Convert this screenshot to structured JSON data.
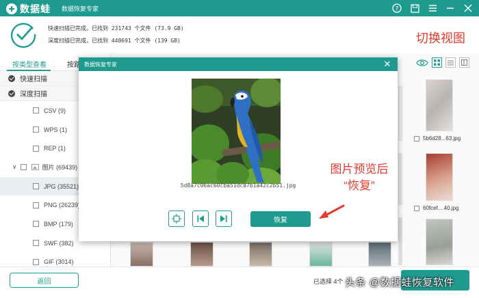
{
  "app": {
    "name": "数据蛙",
    "subtitle": "数据恢复专家"
  },
  "scan": {
    "quick_line": "快速扫描已完成，已找到 231743 个文件 (73.9 GB)",
    "deep_line": "深度扫描已完成，已找到 448691 个文件 (139 GB)"
  },
  "annotations": {
    "switch_view": "切换视图",
    "preview_line1": "图片预览后",
    "preview_line2": "“恢复”"
  },
  "left": {
    "tabs": [
      "按类型查看",
      "按路"
    ],
    "scan_rows": [
      "快速扫描",
      "深度扫描"
    ],
    "items": [
      {
        "label": "CSV (9)"
      },
      {
        "label": "WPS (1)"
      },
      {
        "label": "REP (1)"
      },
      {
        "label": "图片 (69439)"
      },
      {
        "label": "JPG (35521)"
      },
      {
        "label": "PNG (26239)"
      },
      {
        "label": "BMP (179)"
      },
      {
        "label": "SWF (382)"
      },
      {
        "label": "GIF (3014)"
      }
    ]
  },
  "grid": {
    "labels": [
      "5b6d28...63.jpg",
      "60fcef....40.jpg"
    ]
  },
  "modal": {
    "title": "数据恢复专家",
    "filename": "5d8a7c06ac60cba51dc87b1a42c2b51.jpg",
    "recover_label": "恢复"
  },
  "bottom": {
    "back_label": "返回",
    "selected_info": "已选择 4个"
  },
  "watermark": "头条 @数据蛙恢复软件",
  "colors": {
    "brand": "#1f9a8f",
    "annotation": "#e23b2e"
  }
}
